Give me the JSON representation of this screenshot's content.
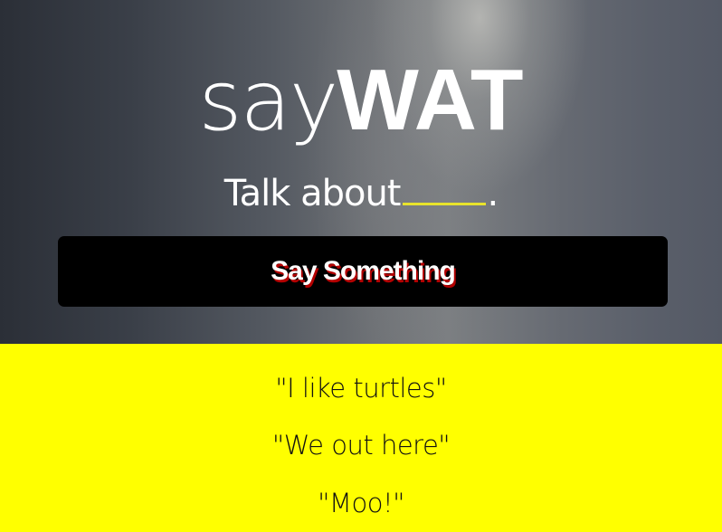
{
  "header": {
    "logo_light": "say",
    "logo_bold": "WAT",
    "tagline_prefix": "Talk about",
    "tagline_suffix": "."
  },
  "action": {
    "say_button_label": "Say Something"
  },
  "quotes": [
    "\"I like turtles\"",
    "\"We out here\"",
    "\"Moo!\""
  ],
  "colors": {
    "accent_yellow": "#ffff00",
    "blank_underline": "#e8e32c",
    "button_bg": "#000000",
    "button_text_shadow": "#b30000"
  }
}
